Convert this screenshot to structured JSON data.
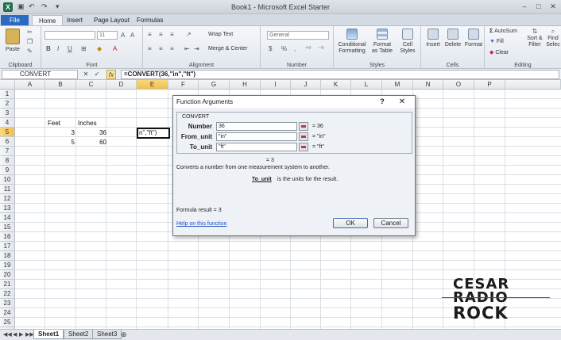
{
  "window": {
    "title": "Book1 - Microsoft Excel Starter",
    "app_icon": "X",
    "quick_access": [
      "save-icon",
      "undo-icon",
      "redo-icon",
      "customize-icon"
    ],
    "controls": [
      "–",
      "□",
      "✕"
    ]
  },
  "ribbon": {
    "file_tab": "File",
    "tabs": [
      "Home",
      "Insert",
      "Page Layout",
      "Formulas"
    ],
    "active_tab": "Home",
    "clipboard": {
      "paste": "Paste",
      "label": "Clipboard"
    },
    "font": {
      "size": "11",
      "label": "Font",
      "bold": "B",
      "italic": "I",
      "underline": "U"
    },
    "alignment": {
      "wrap": "Wrap Text",
      "merge": "Merge & Center",
      "label": "Alignment"
    },
    "number": {
      "format": "General",
      "currency": "$",
      "percent": "%",
      "comma": ",",
      "label": "Number"
    },
    "styles": {
      "conditional": "Conditional",
      "conditional2": "Formatting",
      "format_table": "Format",
      "format_table2": "as Table",
      "cell_styles": "Cell",
      "cell_styles2": "Styles",
      "label": "Styles"
    },
    "cells": {
      "insert": "Insert",
      "delete": "Delete",
      "format": "Format",
      "label": "Cells"
    },
    "editing": {
      "autosum": "AutoSum",
      "fill": "Fill",
      "clear": "Clear",
      "sort": "Sort &",
      "sort2": "Filter",
      "find": "Find",
      "find2": "Selec",
      "label": "Editing"
    }
  },
  "formula_bar": {
    "name_box": "CONVERT",
    "cancel": "✕",
    "enter": "✓",
    "fx": "fx",
    "formula": "=CONVERT(36,\"in\",\"ft\")"
  },
  "grid": {
    "columns": [
      "A",
      "B",
      "C",
      "D",
      "E",
      "F",
      "G",
      "H",
      "I",
      "J",
      "K",
      "L",
      "M",
      "N",
      "O",
      "P",
      "Q"
    ],
    "rows": [
      "1",
      "2",
      "3",
      "4",
      "5",
      "6",
      "7",
      "8",
      "9",
      "10",
      "11",
      "12",
      "13",
      "14",
      "15",
      "16",
      "17",
      "18",
      "19",
      "20",
      "21",
      "22",
      "23",
      "24",
      "25",
      "26"
    ],
    "selected_column": "E",
    "selected_row": "5",
    "cells": {
      "B4": "Feet",
      "C4": "Inches",
      "B5": "3",
      "C5": "36",
      "B6": "5",
      "C6": "60",
      "E5": "n\",\"ft\")"
    }
  },
  "sheets": {
    "tabs": [
      "Sheet1",
      "Sheet2",
      "Sheet3"
    ],
    "active": "Sheet1",
    "nav": [
      "◀◀",
      "◀",
      "▶",
      "▶▶"
    ]
  },
  "dialog": {
    "title": "Function Arguments",
    "help_symbol": "?",
    "close_symbol": "✕",
    "function_name": "CONVERT",
    "args": [
      {
        "label": "Number",
        "value": "36",
        "result": "=  36"
      },
      {
        "label": "From_unit",
        "value": "\"in\"",
        "result": "=  \"in\""
      },
      {
        "label": "To_unit",
        "value": "\"ft\"",
        "result": "=  \"ft\""
      }
    ],
    "overall_result": "=  3",
    "description": "Converts a number from one measurement system to another.",
    "arg_help_name": "To_unit",
    "arg_help_text": "is the units for the result.",
    "formula_result": "Formula result =  3",
    "help_link": "Help on this function",
    "ok": "OK",
    "cancel": "Cancel"
  },
  "watermark": {
    "line1": "CESAR",
    "line2": "RADIO",
    "line3": "ROCK"
  }
}
